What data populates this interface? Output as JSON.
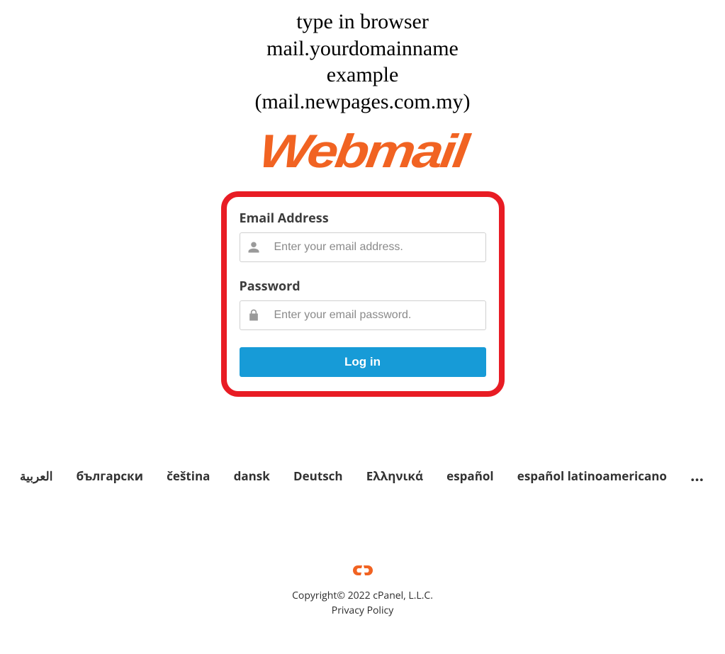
{
  "instructions": {
    "line1": "type in browser",
    "line2": "mail.yourdomainname",
    "line3": "example",
    "line4": "(mail.newpages.com.my)"
  },
  "logo_text": "Webmail",
  "form": {
    "email_label": "Email Address",
    "email_placeholder": "Enter your email address.",
    "password_label": "Password",
    "password_placeholder": "Enter your email password.",
    "login_button": "Log in"
  },
  "locales": [
    "العربية",
    "български",
    "čeština",
    "dansk",
    "Deutsch",
    "Ελληνικά",
    "español",
    "español latinoamericano"
  ],
  "locale_more": "…",
  "footer": {
    "copyright": "Copyright© 2022 cPanel, L.L.C.",
    "privacy": "Privacy Policy"
  }
}
